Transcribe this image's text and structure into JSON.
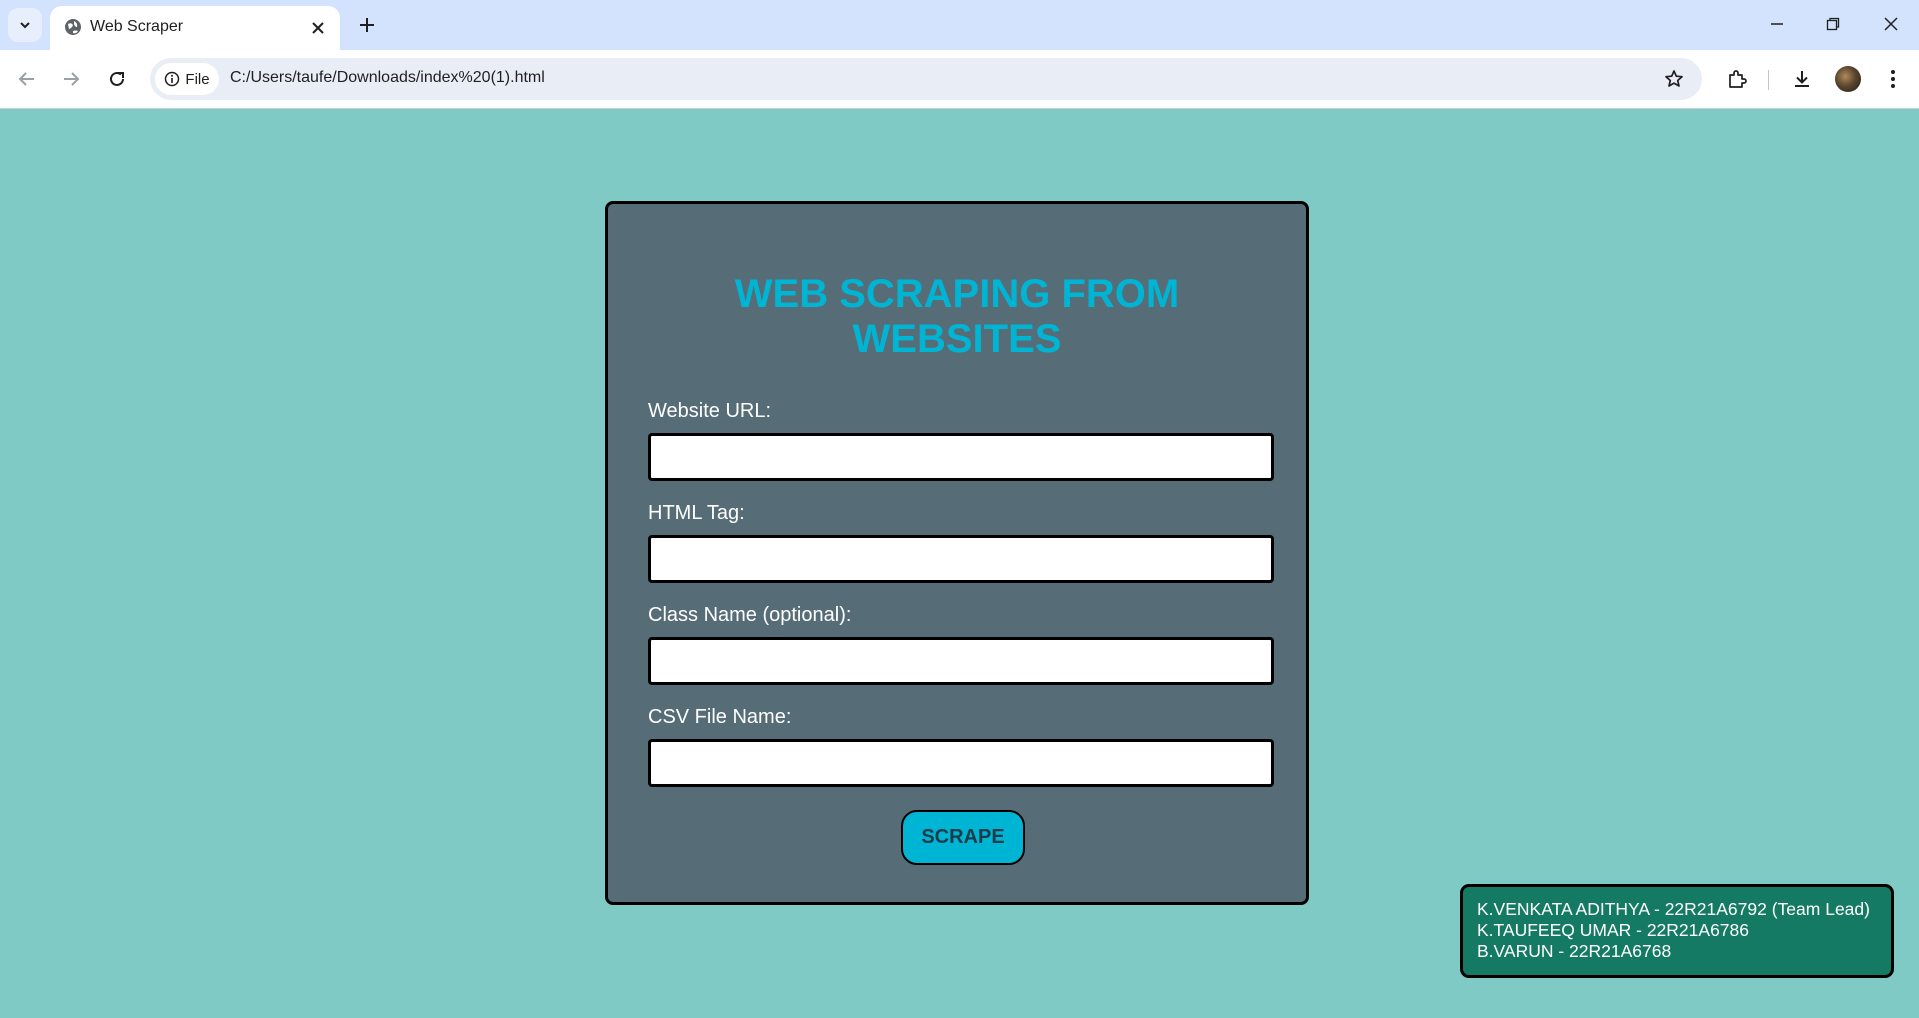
{
  "browser": {
    "tab_title": "Web Scraper",
    "site_chip_label": "File",
    "url": "C:/Users/taufe/Downloads/index%20(1).html"
  },
  "page": {
    "title": "WEB SCRAPING FROM WEBSITES",
    "fields": [
      {
        "label": "Website URL:",
        "value": "",
        "placeholder": ""
      },
      {
        "label": "HTML Tag:",
        "value": "",
        "placeholder": ""
      },
      {
        "label": "Class Name (optional):",
        "value": "",
        "placeholder": ""
      },
      {
        "label": "CSV File Name:",
        "value": "",
        "placeholder": ""
      }
    ],
    "submit_label": "SCRAPE"
  },
  "credits": [
    "K.VENKATA ADITHYA - 22R21A6792 (Team Lead)",
    "K.TAUFEEQ UMAR - 22R21A6786",
    "B.VARUN - 22R21A6768"
  ],
  "colors": {
    "page_background": "#7fcac4",
    "card_background": "#566d77",
    "accent": "#00b4d4",
    "credits_background": "#157a64"
  }
}
